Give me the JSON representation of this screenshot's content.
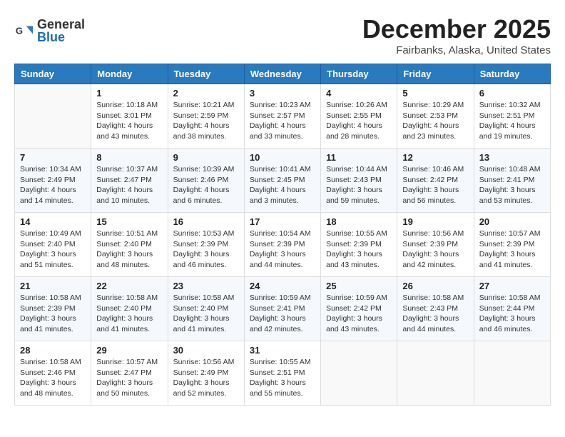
{
  "header": {
    "logo_general": "General",
    "logo_blue": "Blue",
    "month_title": "December 2025",
    "location": "Fairbanks, Alaska, United States"
  },
  "days_of_week": [
    "Sunday",
    "Monday",
    "Tuesday",
    "Wednesday",
    "Thursday",
    "Friday",
    "Saturday"
  ],
  "weeks": [
    [
      {
        "day": "",
        "info": ""
      },
      {
        "day": "1",
        "info": "Sunrise: 10:18 AM\nSunset: 3:01 PM\nDaylight: 4 hours\nand 43 minutes."
      },
      {
        "day": "2",
        "info": "Sunrise: 10:21 AM\nSunset: 2:59 PM\nDaylight: 4 hours\nand 38 minutes."
      },
      {
        "day": "3",
        "info": "Sunrise: 10:23 AM\nSunset: 2:57 PM\nDaylight: 4 hours\nand 33 minutes."
      },
      {
        "day": "4",
        "info": "Sunrise: 10:26 AM\nSunset: 2:55 PM\nDaylight: 4 hours\nand 28 minutes."
      },
      {
        "day": "5",
        "info": "Sunrise: 10:29 AM\nSunset: 2:53 PM\nDaylight: 4 hours\nand 23 minutes."
      },
      {
        "day": "6",
        "info": "Sunrise: 10:32 AM\nSunset: 2:51 PM\nDaylight: 4 hours\nand 19 minutes."
      }
    ],
    [
      {
        "day": "7",
        "info": "Sunrise: 10:34 AM\nSunset: 2:49 PM\nDaylight: 4 hours\nand 14 minutes."
      },
      {
        "day": "8",
        "info": "Sunrise: 10:37 AM\nSunset: 2:47 PM\nDaylight: 4 hours\nand 10 minutes."
      },
      {
        "day": "9",
        "info": "Sunrise: 10:39 AM\nSunset: 2:46 PM\nDaylight: 4 hours\nand 6 minutes."
      },
      {
        "day": "10",
        "info": "Sunrise: 10:41 AM\nSunset: 2:45 PM\nDaylight: 4 hours\nand 3 minutes."
      },
      {
        "day": "11",
        "info": "Sunrise: 10:44 AM\nSunset: 2:43 PM\nDaylight: 3 hours\nand 59 minutes."
      },
      {
        "day": "12",
        "info": "Sunrise: 10:46 AM\nSunset: 2:42 PM\nDaylight: 3 hours\nand 56 minutes."
      },
      {
        "day": "13",
        "info": "Sunrise: 10:48 AM\nSunset: 2:41 PM\nDaylight: 3 hours\nand 53 minutes."
      }
    ],
    [
      {
        "day": "14",
        "info": "Sunrise: 10:49 AM\nSunset: 2:40 PM\nDaylight: 3 hours\nand 51 minutes."
      },
      {
        "day": "15",
        "info": "Sunrise: 10:51 AM\nSunset: 2:40 PM\nDaylight: 3 hours\nand 48 minutes."
      },
      {
        "day": "16",
        "info": "Sunrise: 10:53 AM\nSunset: 2:39 PM\nDaylight: 3 hours\nand 46 minutes."
      },
      {
        "day": "17",
        "info": "Sunrise: 10:54 AM\nSunset: 2:39 PM\nDaylight: 3 hours\nand 44 minutes."
      },
      {
        "day": "18",
        "info": "Sunrise: 10:55 AM\nSunset: 2:39 PM\nDaylight: 3 hours\nand 43 minutes."
      },
      {
        "day": "19",
        "info": "Sunrise: 10:56 AM\nSunset: 2:39 PM\nDaylight: 3 hours\nand 42 minutes."
      },
      {
        "day": "20",
        "info": "Sunrise: 10:57 AM\nSunset: 2:39 PM\nDaylight: 3 hours\nand 41 minutes."
      }
    ],
    [
      {
        "day": "21",
        "info": "Sunrise: 10:58 AM\nSunset: 2:39 PM\nDaylight: 3 hours\nand 41 minutes."
      },
      {
        "day": "22",
        "info": "Sunrise: 10:58 AM\nSunset: 2:40 PM\nDaylight: 3 hours\nand 41 minutes."
      },
      {
        "day": "23",
        "info": "Sunrise: 10:58 AM\nSunset: 2:40 PM\nDaylight: 3 hours\nand 41 minutes."
      },
      {
        "day": "24",
        "info": "Sunrise: 10:59 AM\nSunset: 2:41 PM\nDaylight: 3 hours\nand 42 minutes."
      },
      {
        "day": "25",
        "info": "Sunrise: 10:59 AM\nSunset: 2:42 PM\nDaylight: 3 hours\nand 43 minutes."
      },
      {
        "day": "26",
        "info": "Sunrise: 10:58 AM\nSunset: 2:43 PM\nDaylight: 3 hours\nand 44 minutes."
      },
      {
        "day": "27",
        "info": "Sunrise: 10:58 AM\nSunset: 2:44 PM\nDaylight: 3 hours\nand 46 minutes."
      }
    ],
    [
      {
        "day": "28",
        "info": "Sunrise: 10:58 AM\nSunset: 2:46 PM\nDaylight: 3 hours\nand 48 minutes."
      },
      {
        "day": "29",
        "info": "Sunrise: 10:57 AM\nSunset: 2:47 PM\nDaylight: 3 hours\nand 50 minutes."
      },
      {
        "day": "30",
        "info": "Sunrise: 10:56 AM\nSunset: 2:49 PM\nDaylight: 3 hours\nand 52 minutes."
      },
      {
        "day": "31",
        "info": "Sunrise: 10:55 AM\nSunset: 2:51 PM\nDaylight: 3 hours\nand 55 minutes."
      },
      {
        "day": "",
        "info": ""
      },
      {
        "day": "",
        "info": ""
      },
      {
        "day": "",
        "info": ""
      }
    ]
  ]
}
